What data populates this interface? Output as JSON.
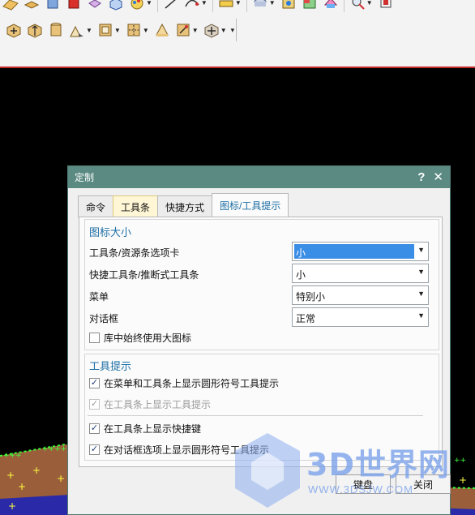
{
  "toolbar": {
    "row1_icons": [
      "surface-icon",
      "block-icon",
      "cube-icon",
      "red-solid-icon",
      "shaded-box-icon",
      "wire-box-icon",
      "color-palette-icon",
      "line-icon",
      "curve-icon",
      "measure-icon",
      "cylinder-icon",
      "analysis-icon",
      "render-icon",
      "zoom-icon",
      "view-icon"
    ],
    "row2_icons": [
      "move-face-icon",
      "offset-face-icon",
      "cylinder-face-icon",
      "replace-face-icon",
      "resize-icon",
      "pattern-face-icon",
      "delete-face-icon",
      "sync-icon",
      "transform-icon"
    ]
  },
  "dialog": {
    "title": "定制",
    "help": "?",
    "close": "✕",
    "tabs": [
      "命令",
      "工具条",
      "快捷方式",
      "图标/工具提示"
    ],
    "icon_size": {
      "heading": "图标大小",
      "rows": [
        {
          "label": "工具条/资源条选项卡",
          "value": "小"
        },
        {
          "label": "快捷工具条/推断式工具条",
          "value": "小"
        },
        {
          "label": "菜单",
          "value": "特别小"
        },
        {
          "label": "对话框",
          "value": "正常"
        }
      ],
      "large_icons_label": "库中始终使用大图标"
    },
    "tooltips": {
      "heading": "工具提示",
      "options": [
        {
          "label": "在菜单和工具条上显示圆形符号工具提示",
          "checked": true,
          "enabled": true
        },
        {
          "label": "在工具条上显示工具提示",
          "checked": true,
          "enabled": false
        },
        {
          "label": "在工具条上显示快捷键",
          "checked": true,
          "enabled": true
        },
        {
          "label": "在对话框选项上显示圆形符号工具提示",
          "checked": true,
          "enabled": true
        }
      ]
    },
    "buttons": {
      "keyboard": "键盘",
      "close": "关闭"
    },
    "checkmark": "✓",
    "dropdown_arrow": "▼"
  },
  "watermark": {
    "text": "3D世界网",
    "url": "WWW.3DSJW.COM"
  }
}
